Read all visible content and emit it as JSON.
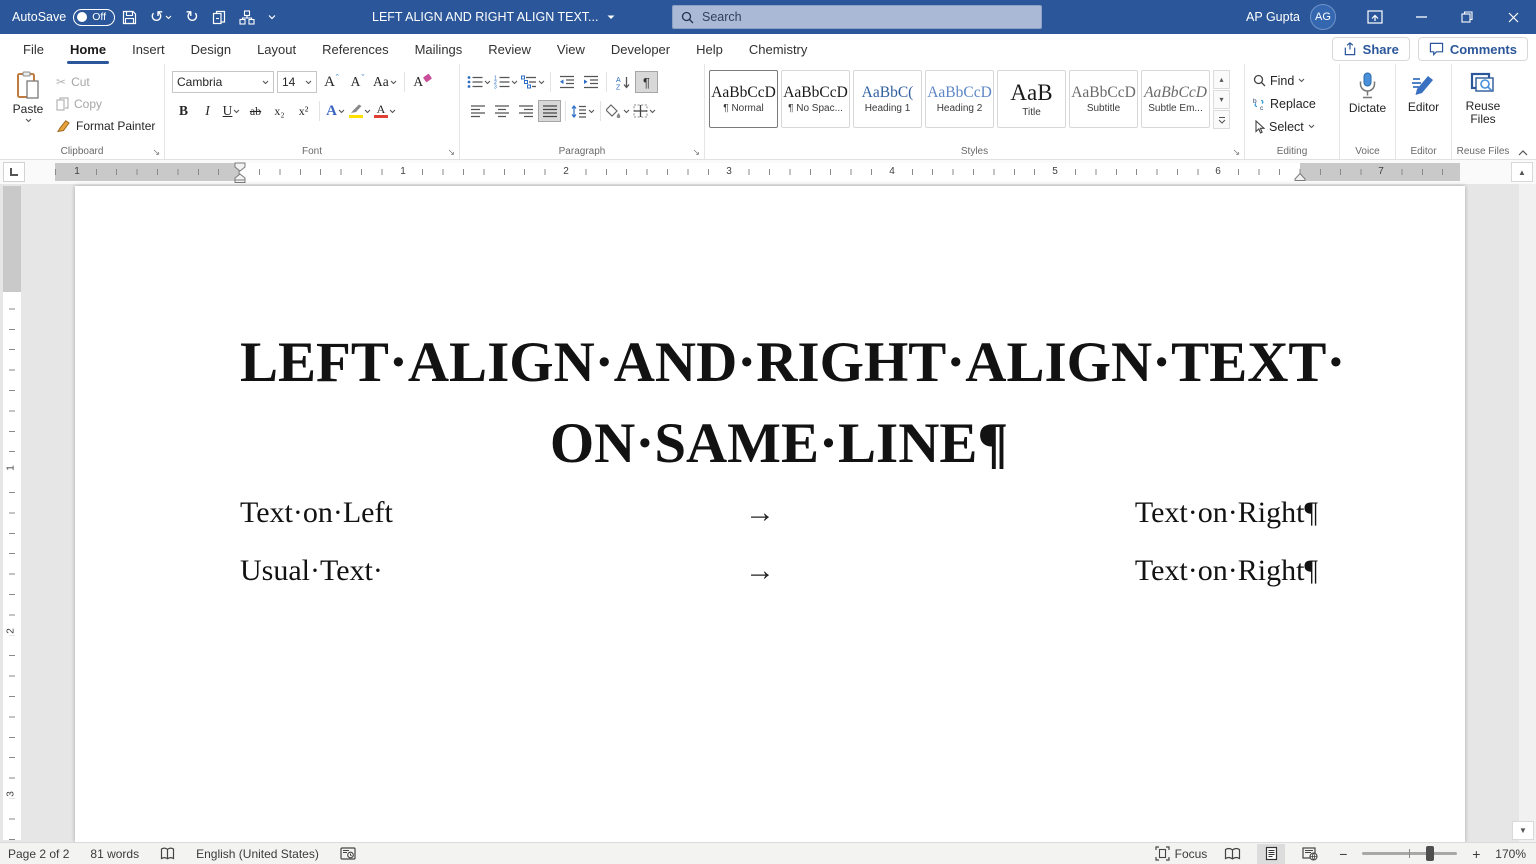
{
  "colors": {
    "titlebar_blue": "#2b579a",
    "accent_blue": "#2b579a",
    "search_box_blue": "#a9b9d6",
    "active_button_gray": "#d8d8d8",
    "heading1_blue": "#2f5f9e",
    "heading2_blue": "#5d87c6",
    "highlight_yellow": "#ffe100",
    "font_color_red": "#e03f32"
  },
  "titlebar": {
    "autosave_label": "AutoSave",
    "autosave_state": "Off",
    "document_title": "LEFT ALIGN AND RIGHT ALIGN TEXT...",
    "search_placeholder": "Search",
    "user_name": "AP Gupta",
    "user_initials": "AG"
  },
  "tabs": {
    "items": [
      "File",
      "Home",
      "Insert",
      "Design",
      "Layout",
      "References",
      "Mailings",
      "Review",
      "View",
      "Developer",
      "Help",
      "Chemistry"
    ],
    "active": "Home",
    "share_label": "Share",
    "comments_label": "Comments"
  },
  "ribbon": {
    "clipboard": {
      "title": "Clipboard",
      "paste_label": "Paste",
      "cut_label": "Cut",
      "copy_label": "Copy",
      "format_painter_label": "Format Painter"
    },
    "font": {
      "title": "Font",
      "family": "Cambria",
      "size": "14",
      "bold": "B",
      "italic": "I",
      "underline": "U",
      "strikethrough": "ab",
      "subscript": "x₂",
      "superscript": "x²",
      "grow": "A",
      "shrink": "A",
      "change_case": "Aa",
      "clear_format": "A",
      "text_effects": "A",
      "font_color": "A"
    },
    "paragraph": {
      "title": "Paragraph",
      "pilcrow": "¶",
      "sort_a": "A",
      "sort_z": "Z"
    },
    "styles": {
      "title": "Styles",
      "items": [
        {
          "preview": "AaBbCcD",
          "label": "¶ Normal"
        },
        {
          "preview": "AaBbCcD",
          "label": "¶ No Spac..."
        },
        {
          "preview": "AaBbC(",
          "label": "Heading 1"
        },
        {
          "preview": "AaBbCcD",
          "label": "Heading 2"
        },
        {
          "preview": "AaB",
          "label": "Title"
        },
        {
          "preview": "AaBbCcD",
          "label": "Subtitle"
        },
        {
          "preview": "AaBbCcD",
          "label": "Subtle Em..."
        }
      ]
    },
    "editing": {
      "title": "Editing",
      "find_label": "Find",
      "replace_label": "Replace",
      "select_label": "Select"
    },
    "voice": {
      "title": "Voice",
      "dictate_label": "Dictate"
    },
    "editor_group": {
      "title": "Editor",
      "editor_label": "Editor"
    },
    "reuse": {
      "title": "Reuse Files",
      "line1": "Reuse",
      "line2": "Files"
    }
  },
  "ruler": {
    "h_numbers": [
      "1",
      "1",
      "2",
      "3",
      "4",
      "5",
      "6",
      "7"
    ],
    "v_numbers": [
      "1",
      "2",
      "3"
    ]
  },
  "document": {
    "title_line1": "LEFT·ALIGN·AND·RIGHT·ALIGN·TEXT·",
    "title_line2": "ON·SAME·LINE¶",
    "rows": [
      {
        "left": "Text·on·Left",
        "tab": "→",
        "right": "Text·on·Right¶"
      },
      {
        "left": "Usual·Text·",
        "tab": "→",
        "right": "Text·on·Right¶"
      }
    ]
  },
  "statusbar": {
    "page_info": "Page 2 of 2",
    "word_count": "81 words",
    "language": "English (United States)",
    "focus_label": "Focus",
    "zoom_level": "170%"
  }
}
